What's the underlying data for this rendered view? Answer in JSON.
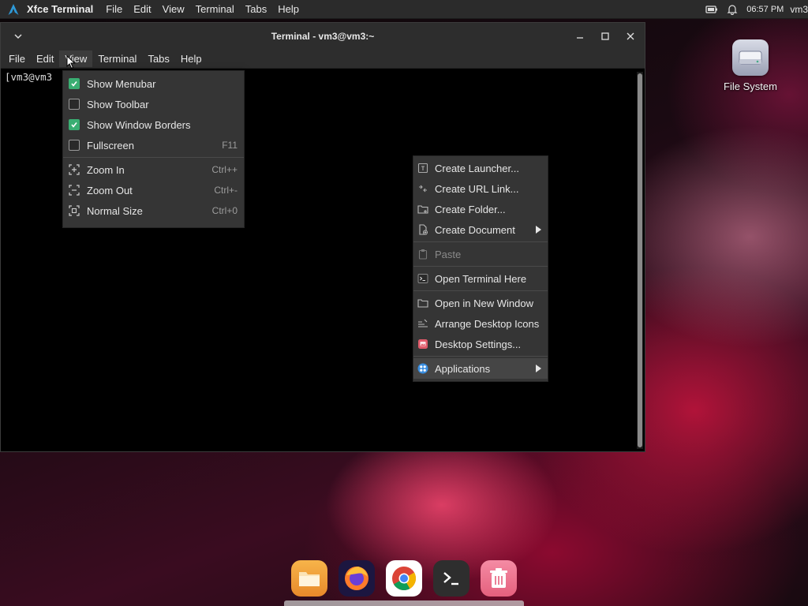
{
  "top_panel": {
    "app_name": "Xfce Terminal",
    "menu": [
      "File",
      "Edit",
      "View",
      "Terminal",
      "Tabs",
      "Help"
    ],
    "clock": "06:57 PM",
    "user": "vm3"
  },
  "terminal": {
    "title": "Terminal - vm3@vm3:~",
    "menubar": [
      "File",
      "Edit",
      "View",
      "Terminal",
      "Tabs",
      "Help"
    ],
    "prompt": "[vm3@vm3"
  },
  "view_menu": {
    "items": [
      {
        "label": "Show Menubar",
        "checked": true
      },
      {
        "label": "Show Toolbar",
        "checked": false
      },
      {
        "label": "Show Window Borders",
        "checked": true
      },
      {
        "label": "Fullscreen",
        "accel": "F11",
        "checked": false
      }
    ],
    "zoom_items": [
      {
        "label": "Zoom In",
        "accel": "Ctrl++",
        "icon": "zoom-in-icon"
      },
      {
        "label": "Zoom Out",
        "accel": "Ctrl+-",
        "icon": "zoom-out-icon"
      },
      {
        "label": "Normal Size",
        "accel": "Ctrl+0",
        "icon": "zoom-reset-icon"
      }
    ]
  },
  "desktop_menu": {
    "items": [
      {
        "label": "Create Launcher...",
        "icon": "launcher-icon"
      },
      {
        "label": "Create URL Link...",
        "icon": "link-icon"
      },
      {
        "label": "Create Folder...",
        "icon": "folder-new-icon"
      },
      {
        "label": "Create Document",
        "icon": "document-new-icon",
        "submenu": true
      },
      {
        "label": "Paste",
        "icon": "paste-icon",
        "disabled": true
      },
      {
        "label": "Open Terminal Here",
        "icon": "terminal-icon"
      },
      {
        "label": "Open in New Window",
        "icon": "folder-icon"
      },
      {
        "label": "Arrange Desktop Icons",
        "icon": "arrange-icon"
      },
      {
        "label": "Desktop Settings...",
        "icon": "desktop-settings-icon"
      },
      {
        "label": "Applications",
        "icon": "applications-icon",
        "submenu": true
      }
    ]
  },
  "desktop": {
    "icon_label": "File System"
  },
  "dock": {
    "apps": [
      "file-manager-icon",
      "firefox-icon",
      "chrome-icon",
      "terminal-icon",
      "trash-icon"
    ]
  },
  "colors": {
    "check_accent": "#3aae72",
    "panel_bg": "#2b2b2b",
    "menu_bg": "#353535"
  }
}
